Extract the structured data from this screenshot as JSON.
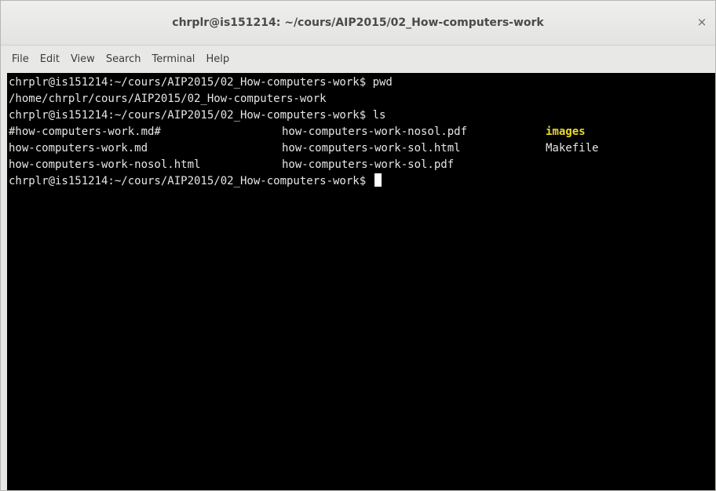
{
  "window": {
    "title": "chrplr@is151214: ~/cours/AIP2015/02_How-computers-work",
    "close_glyph": "×"
  },
  "menubar": {
    "items": [
      "File",
      "Edit",
      "View",
      "Search",
      "Terminal",
      "Help"
    ]
  },
  "terminal": {
    "prompt1": "chrplr@is151214:~/cours/AIP2015/02_How-computers-work$ pwd",
    "pwd_output": "/home/chrplr/cours/AIP2015/02_How-computers-work",
    "prompt2": "chrplr@is151214:~/cours/AIP2015/02_How-computers-work$ ls",
    "ls_rows": [
      [
        "#how-computers-work.md#",
        "how-computers-work-nosol.pdf",
        "images"
      ],
      [
        "how-computers-work.md",
        "how-computers-work-sol.html",
        "Makefile"
      ],
      [
        "how-computers-work-nosol.html",
        "how-computers-work-sol.pdf",
        ""
      ]
    ],
    "prompt3": "chrplr@is151214:~/cours/AIP2015/02_How-computers-work$ ",
    "colors": {
      "background": "#000000",
      "text": "#e6e6e6",
      "directory": "#e9d92a",
      "cursor": "#ffffff"
    }
  }
}
